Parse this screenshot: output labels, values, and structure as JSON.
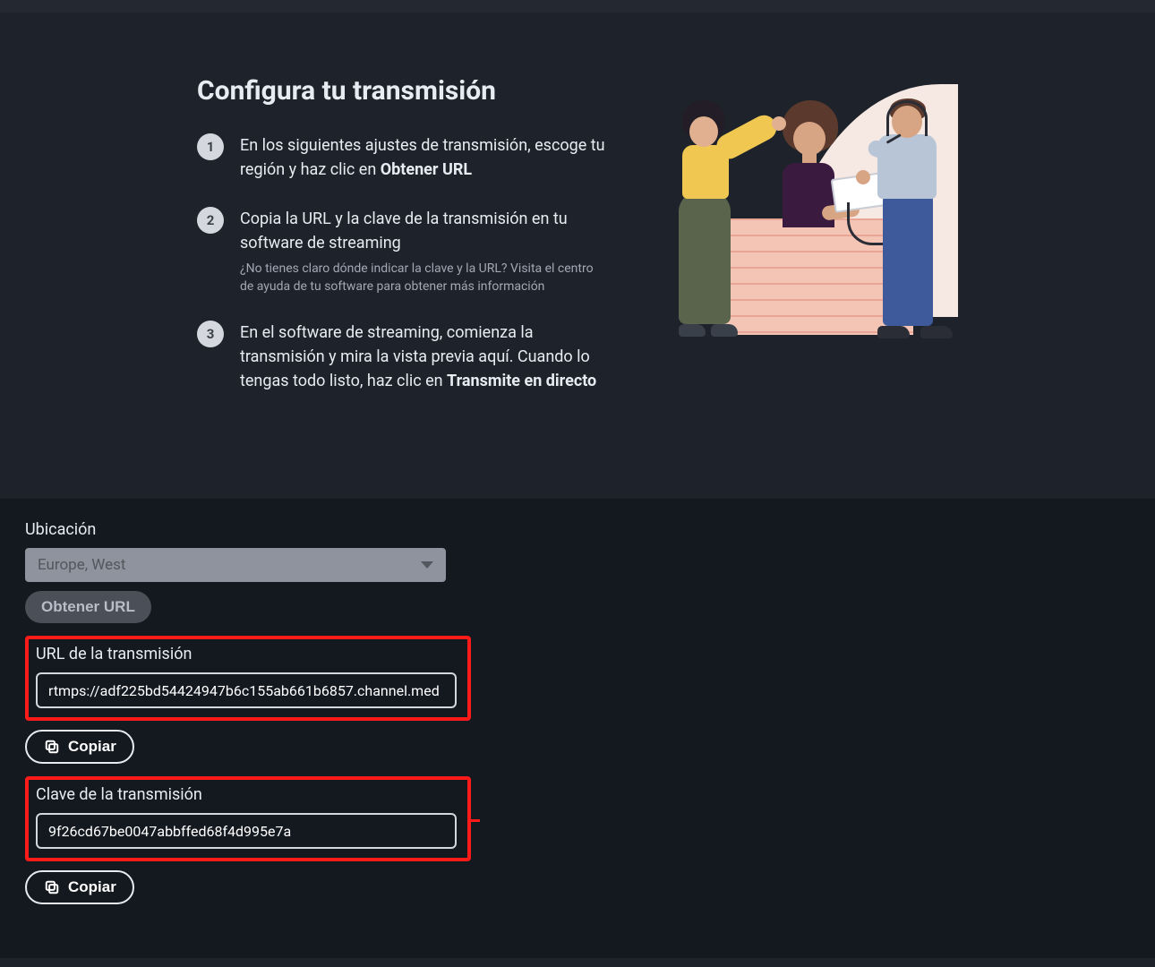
{
  "instructions": {
    "title": "Configura tu transmisión",
    "steps": [
      {
        "num": "1",
        "text_before": "En los siguientes ajustes de transmisión, escoge tu región y haz clic en ",
        "bold": "Obtener URL",
        "text_after": "",
        "subtext": ""
      },
      {
        "num": "2",
        "text_before": "Copia la URL y la clave de la transmisión en tu software de streaming",
        "bold": "",
        "text_after": "",
        "subtext": "¿No tienes claro dónde indicar la clave y la URL? Visita el centro de ayuda de tu software para obtener más información"
      },
      {
        "num": "3",
        "text_before": "En el software de streaming, comienza la transmisión y mira la vista previa aquí. Cuando lo tengas todo listo, haz clic en ",
        "bold": "Transmite en directo",
        "text_after": "",
        "subtext": ""
      }
    ]
  },
  "settings": {
    "location_label": "Ubicación",
    "location_value": "Europe, West",
    "get_url_label": "Obtener URL",
    "stream_url_label": "URL de la transmisión",
    "stream_url_value": "rtmps://adf225bd54424947b6c155ab661b6857.channel.med",
    "copy_label": "Copiar",
    "stream_key_label": "Clave de la transmisión",
    "stream_key_value": "9f26cd67be0047abbffed68f4d995e7a"
  }
}
